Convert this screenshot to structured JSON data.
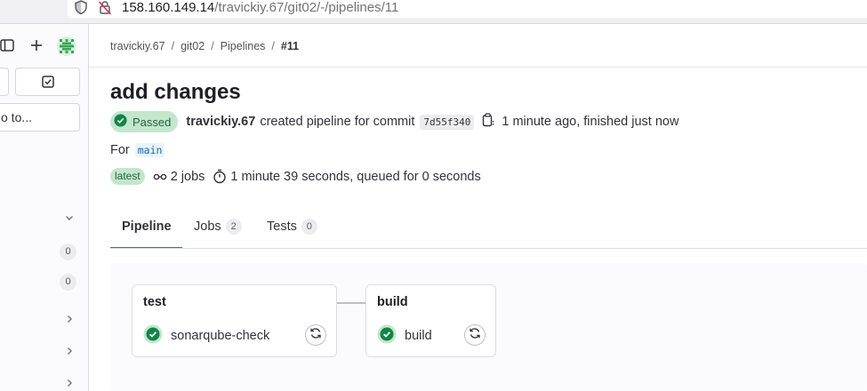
{
  "browser": {
    "url_host": "158.160.149.14",
    "url_path": "/travickiy.67/git02/-/pipelines/11"
  },
  "sidebar": {
    "search_label": "o to...",
    "counts": [
      "0",
      "0"
    ]
  },
  "breadcrumb": {
    "items": [
      "travickiy.67",
      "git02",
      "Pipelines"
    ],
    "current": "#11"
  },
  "pipeline": {
    "title": "add changes",
    "status": "Passed",
    "user": "travickiy.67",
    "created_text": "created pipeline for commit",
    "commit_sha": "7d55f340",
    "time_text": "1 minute ago, finished just now",
    "for_label": "For",
    "branch": "main",
    "latest_badge": "latest",
    "jobs_text": "2 jobs",
    "duration_text": "1 minute 39 seconds, queued for 0 seconds"
  },
  "tabs": [
    {
      "label": "Pipeline",
      "count": null
    },
    {
      "label": "Jobs",
      "count": "2"
    },
    {
      "label": "Tests",
      "count": "0"
    }
  ],
  "stages": [
    {
      "name": "test",
      "jobs": [
        {
          "name": "sonarqube-check",
          "status": "success"
        }
      ]
    },
    {
      "name": "build",
      "jobs": [
        {
          "name": "build",
          "status": "success"
        }
      ]
    }
  ],
  "colors": {
    "success": "#108548",
    "success_bg": "#c3e6cd",
    "tab_active": "#1f75cb",
    "link": "#1068bf"
  }
}
